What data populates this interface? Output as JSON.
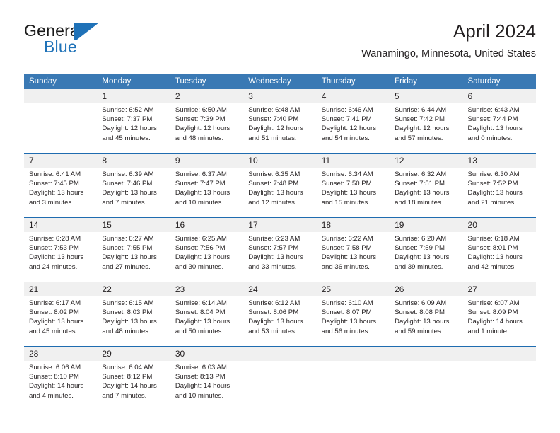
{
  "brand": {
    "name_top": "General",
    "name_bottom": "Blue",
    "accent_color": "#1f72b8",
    "mark": "triangle-logo-mark"
  },
  "header": {
    "title": "April 2024",
    "subtitle": "Wanamingo, Minnesota, United States"
  },
  "calendar": {
    "header_bg": "#3a79b4",
    "header_text_color": "#ffffff",
    "daynum_bg": "#f0f0f0",
    "week_rule_color": "#1f6cb0",
    "weekday_headers": [
      "Sunday",
      "Monday",
      "Tuesday",
      "Wednesday",
      "Thursday",
      "Friday",
      "Saturday"
    ],
    "weeks": [
      [
        {
          "day": "",
          "sunrise": "",
          "sunset": "",
          "daylight1": "",
          "daylight2": ""
        },
        {
          "day": "1",
          "sunrise": "Sunrise: 6:52 AM",
          "sunset": "Sunset: 7:37 PM",
          "daylight1": "Daylight: 12 hours",
          "daylight2": "and 45 minutes."
        },
        {
          "day": "2",
          "sunrise": "Sunrise: 6:50 AM",
          "sunset": "Sunset: 7:39 PM",
          "daylight1": "Daylight: 12 hours",
          "daylight2": "and 48 minutes."
        },
        {
          "day": "3",
          "sunrise": "Sunrise: 6:48 AM",
          "sunset": "Sunset: 7:40 PM",
          "daylight1": "Daylight: 12 hours",
          "daylight2": "and 51 minutes."
        },
        {
          "day": "4",
          "sunrise": "Sunrise: 6:46 AM",
          "sunset": "Sunset: 7:41 PM",
          "daylight1": "Daylight: 12 hours",
          "daylight2": "and 54 minutes."
        },
        {
          "day": "5",
          "sunrise": "Sunrise: 6:44 AM",
          "sunset": "Sunset: 7:42 PM",
          "daylight1": "Daylight: 12 hours",
          "daylight2": "and 57 minutes."
        },
        {
          "day": "6",
          "sunrise": "Sunrise: 6:43 AM",
          "sunset": "Sunset: 7:44 PM",
          "daylight1": "Daylight: 13 hours",
          "daylight2": "and 0 minutes."
        }
      ],
      [
        {
          "day": "7",
          "sunrise": "Sunrise: 6:41 AM",
          "sunset": "Sunset: 7:45 PM",
          "daylight1": "Daylight: 13 hours",
          "daylight2": "and 3 minutes."
        },
        {
          "day": "8",
          "sunrise": "Sunrise: 6:39 AM",
          "sunset": "Sunset: 7:46 PM",
          "daylight1": "Daylight: 13 hours",
          "daylight2": "and 7 minutes."
        },
        {
          "day": "9",
          "sunrise": "Sunrise: 6:37 AM",
          "sunset": "Sunset: 7:47 PM",
          "daylight1": "Daylight: 13 hours",
          "daylight2": "and 10 minutes."
        },
        {
          "day": "10",
          "sunrise": "Sunrise: 6:35 AM",
          "sunset": "Sunset: 7:48 PM",
          "daylight1": "Daylight: 13 hours",
          "daylight2": "and 12 minutes."
        },
        {
          "day": "11",
          "sunrise": "Sunrise: 6:34 AM",
          "sunset": "Sunset: 7:50 PM",
          "daylight1": "Daylight: 13 hours",
          "daylight2": "and 15 minutes."
        },
        {
          "day": "12",
          "sunrise": "Sunrise: 6:32 AM",
          "sunset": "Sunset: 7:51 PM",
          "daylight1": "Daylight: 13 hours",
          "daylight2": "and 18 minutes."
        },
        {
          "day": "13",
          "sunrise": "Sunrise: 6:30 AM",
          "sunset": "Sunset: 7:52 PM",
          "daylight1": "Daylight: 13 hours",
          "daylight2": "and 21 minutes."
        }
      ],
      [
        {
          "day": "14",
          "sunrise": "Sunrise: 6:28 AM",
          "sunset": "Sunset: 7:53 PM",
          "daylight1": "Daylight: 13 hours",
          "daylight2": "and 24 minutes."
        },
        {
          "day": "15",
          "sunrise": "Sunrise: 6:27 AM",
          "sunset": "Sunset: 7:55 PM",
          "daylight1": "Daylight: 13 hours",
          "daylight2": "and 27 minutes."
        },
        {
          "day": "16",
          "sunrise": "Sunrise: 6:25 AM",
          "sunset": "Sunset: 7:56 PM",
          "daylight1": "Daylight: 13 hours",
          "daylight2": "and 30 minutes."
        },
        {
          "day": "17",
          "sunrise": "Sunrise: 6:23 AM",
          "sunset": "Sunset: 7:57 PM",
          "daylight1": "Daylight: 13 hours",
          "daylight2": "and 33 minutes."
        },
        {
          "day": "18",
          "sunrise": "Sunrise: 6:22 AM",
          "sunset": "Sunset: 7:58 PM",
          "daylight1": "Daylight: 13 hours",
          "daylight2": "and 36 minutes."
        },
        {
          "day": "19",
          "sunrise": "Sunrise: 6:20 AM",
          "sunset": "Sunset: 7:59 PM",
          "daylight1": "Daylight: 13 hours",
          "daylight2": "and 39 minutes."
        },
        {
          "day": "20",
          "sunrise": "Sunrise: 6:18 AM",
          "sunset": "Sunset: 8:01 PM",
          "daylight1": "Daylight: 13 hours",
          "daylight2": "and 42 minutes."
        }
      ],
      [
        {
          "day": "21",
          "sunrise": "Sunrise: 6:17 AM",
          "sunset": "Sunset: 8:02 PM",
          "daylight1": "Daylight: 13 hours",
          "daylight2": "and 45 minutes."
        },
        {
          "day": "22",
          "sunrise": "Sunrise: 6:15 AM",
          "sunset": "Sunset: 8:03 PM",
          "daylight1": "Daylight: 13 hours",
          "daylight2": "and 48 minutes."
        },
        {
          "day": "23",
          "sunrise": "Sunrise: 6:14 AM",
          "sunset": "Sunset: 8:04 PM",
          "daylight1": "Daylight: 13 hours",
          "daylight2": "and 50 minutes."
        },
        {
          "day": "24",
          "sunrise": "Sunrise: 6:12 AM",
          "sunset": "Sunset: 8:06 PM",
          "daylight1": "Daylight: 13 hours",
          "daylight2": "and 53 minutes."
        },
        {
          "day": "25",
          "sunrise": "Sunrise: 6:10 AM",
          "sunset": "Sunset: 8:07 PM",
          "daylight1": "Daylight: 13 hours",
          "daylight2": "and 56 minutes."
        },
        {
          "day": "26",
          "sunrise": "Sunrise: 6:09 AM",
          "sunset": "Sunset: 8:08 PM",
          "daylight1": "Daylight: 13 hours",
          "daylight2": "and 59 minutes."
        },
        {
          "day": "27",
          "sunrise": "Sunrise: 6:07 AM",
          "sunset": "Sunset: 8:09 PM",
          "daylight1": "Daylight: 14 hours",
          "daylight2": "and 1 minute."
        }
      ],
      [
        {
          "day": "28",
          "sunrise": "Sunrise: 6:06 AM",
          "sunset": "Sunset: 8:10 PM",
          "daylight1": "Daylight: 14 hours",
          "daylight2": "and 4 minutes."
        },
        {
          "day": "29",
          "sunrise": "Sunrise: 6:04 AM",
          "sunset": "Sunset: 8:12 PM",
          "daylight1": "Daylight: 14 hours",
          "daylight2": "and 7 minutes."
        },
        {
          "day": "30",
          "sunrise": "Sunrise: 6:03 AM",
          "sunset": "Sunset: 8:13 PM",
          "daylight1": "Daylight: 14 hours",
          "daylight2": "and 10 minutes."
        },
        {
          "day": "",
          "sunrise": "",
          "sunset": "",
          "daylight1": "",
          "daylight2": ""
        },
        {
          "day": "",
          "sunrise": "",
          "sunset": "",
          "daylight1": "",
          "daylight2": ""
        },
        {
          "day": "",
          "sunrise": "",
          "sunset": "",
          "daylight1": "",
          "daylight2": ""
        },
        {
          "day": "",
          "sunrise": "",
          "sunset": "",
          "daylight1": "",
          "daylight2": ""
        }
      ]
    ]
  }
}
